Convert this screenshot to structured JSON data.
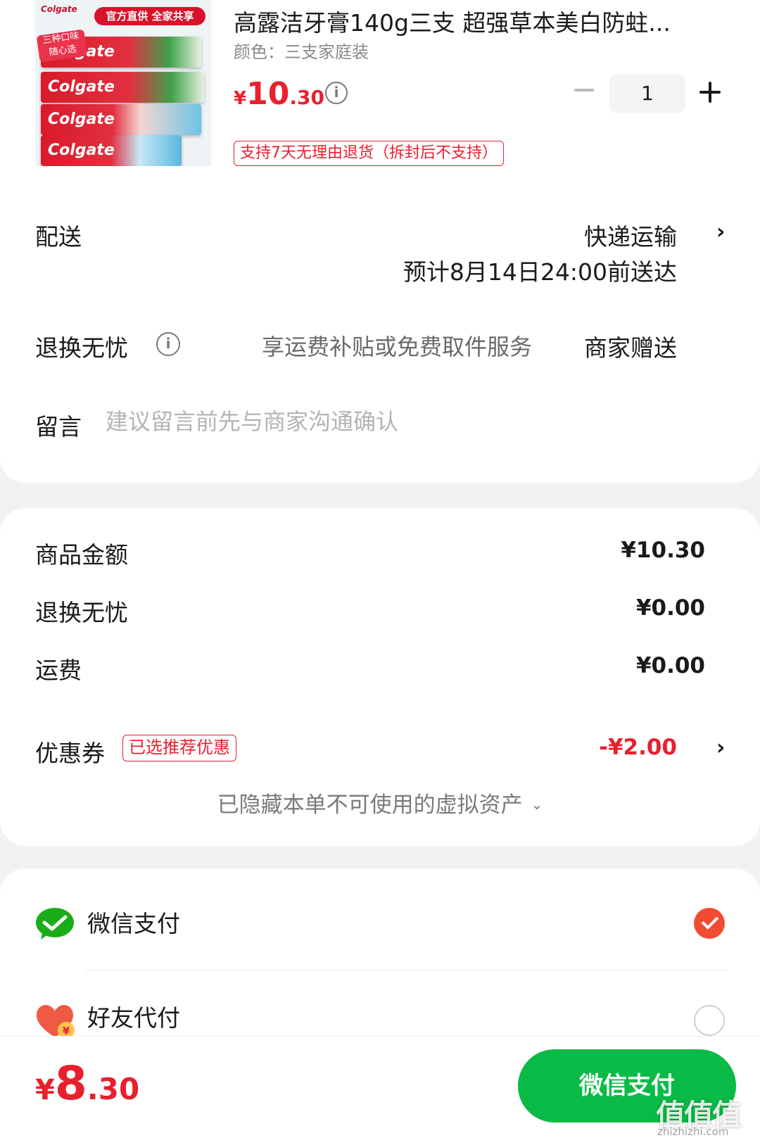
{
  "product": {
    "image_brand": "Colgate",
    "image_banner": "官方直供 全家共享",
    "image_tag": "三种口味 随心选",
    "title": "高露洁牙膏140g三支 超强草本美白防蛀...",
    "variant": "颜色：三支家庭装",
    "price_symbol": "¥",
    "price_int": "10",
    "price_dec": ".30",
    "quantity": "1",
    "return_badge": "支持7天无理由退货（拆封后不支持）"
  },
  "delivery": {
    "label": "配送",
    "method": "快递运输",
    "eta": "预计8月14日24:00前送达"
  },
  "worry_free": {
    "label": "退换无忧",
    "description": "享运费补贴或免费取件服务",
    "gift": "商家赠送"
  },
  "message": {
    "label": "留言",
    "placeholder": "建议留言前先与商家沟通确认"
  },
  "amounts": {
    "goods_label": "商品金额",
    "goods_value": "¥10.30",
    "worry_label": "退换无忧",
    "worry_value": "¥0.00",
    "shipping_label": "运费",
    "shipping_value": "¥0.00",
    "coupon_label": "优惠券",
    "coupon_badge": "已选推荐优惠",
    "coupon_value": "-¥2.00",
    "hidden_assets": "已隐藏本单不可使用的虚拟资产"
  },
  "payment": {
    "wechat_label": "微信支付",
    "friend_label": "好友代付",
    "wechat_selected": true,
    "friend_selected": false
  },
  "footer": {
    "total_symbol": "¥",
    "total_int": "8",
    "total_dec": ".30",
    "pay_button": "微信支付",
    "watermark": "值值值",
    "watermark_url": "zhizhizhi.com"
  },
  "colors": {
    "accent_red": "#e8202e",
    "wechat_green": "#09bb46",
    "check_orange": "#f14b32"
  },
  "icons": [
    "info-icon",
    "chevron-right-icon",
    "chevron-down-icon",
    "minus-icon",
    "plus-icon",
    "wechat-pay-icon",
    "friend-pay-heart-icon",
    "check-icon"
  ]
}
